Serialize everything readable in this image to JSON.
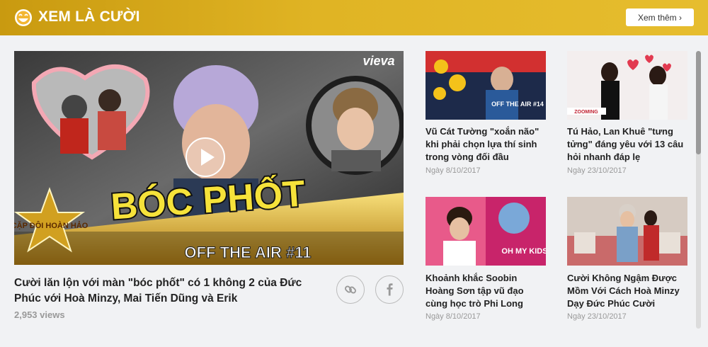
{
  "header": {
    "title": "XEM LÀ CƯỜI",
    "more_label": "Xem thêm ›",
    "icon": "laughing-face-icon",
    "accent": "#d9aa1c"
  },
  "featured": {
    "thumb_text": "BÓC PHỐT",
    "thumb_subtitle": "OFF THE AIR #11",
    "thumb_brand": "vieva",
    "thumb_badge": "CẶP ĐÔI HOÀN HẢO",
    "title": "Cười lăn lộn với màn \"bóc phốt\" có 1 không 2 của Đức Phúc với Hoà Minzy, Mai Tiến Dũng và Erik",
    "views": "2,953 views",
    "share_icons": [
      "link-icon",
      "facebook-icon"
    ]
  },
  "cards": [
    {
      "title": "Vũ Cát Tường \"xoắn não\" khi phải chọn lựa thí sinh trong vòng đối đầu",
      "date": "Ngày 8/10/2017",
      "thumb_text": "OFF THE AIR #14"
    },
    {
      "title": "Tú Hảo, Lan Khuê \"tưng tửng\" đáng yêu với 13 câu hỏi nhanh đáp lẹ",
      "date": "Ngày 23/10/2017",
      "thumb_text": "ZOOMING"
    },
    {
      "title": "Khoảnh khắc Soobin Hoàng Sơn tập vũ đạo cùng học trò Phi Long",
      "date": "Ngày 8/10/2017",
      "thumb_text": "OH MY KIDS"
    },
    {
      "title": "Cười Không Ngậm Được Mồm Với Cách Hoà Minzy Dạy Đức Phúc Cười",
      "date": "Ngày 23/10/2017",
      "thumb_text": ""
    }
  ]
}
